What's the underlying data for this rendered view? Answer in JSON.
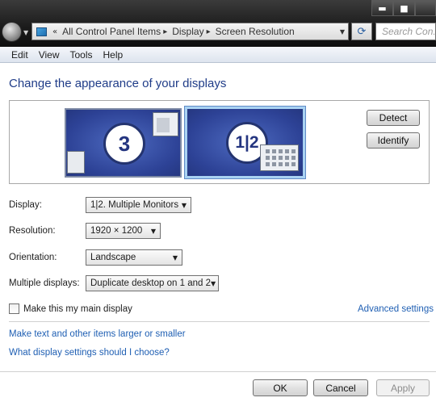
{
  "window": {
    "minimize_glyph": "▬",
    "maximize_glyph": "■",
    "close_glyph": ""
  },
  "address_bar": {
    "overflow_glyph": "«",
    "crumbs": [
      "All Control Panel Items",
      "Display",
      "Screen Resolution"
    ],
    "separator": "▸",
    "dropdown_glyph": "▼",
    "refresh_glyph": "⟳"
  },
  "search": {
    "placeholder": "Search Con..."
  },
  "menu": {
    "items": [
      "Edit",
      "View",
      "Tools",
      "Help"
    ]
  },
  "page": {
    "heading": "Change the appearance of your displays"
  },
  "preview": {
    "monitors": [
      {
        "label": "3"
      },
      {
        "label": "1|2"
      }
    ],
    "detect_label": "Detect",
    "identify_label": "Identify"
  },
  "settings": {
    "display": {
      "label": "Display:",
      "value": "1|2. Multiple Monitors"
    },
    "resolution": {
      "label": "Resolution:",
      "value": "1920 × 1200"
    },
    "orientation": {
      "label": "Orientation:",
      "value": "Landscape"
    },
    "multiple_displays": {
      "label": "Multiple displays:",
      "value": "Duplicate desktop on 1 and 2"
    },
    "dropdown_glyph": "▼"
  },
  "main_display": {
    "label": "Make this my main display",
    "checked": false
  },
  "links": {
    "advanced": "Advanced settings",
    "larger_text": "Make text and other items larger or smaller",
    "which_settings": "What display settings should I choose?"
  },
  "buttons": {
    "ok": "OK",
    "cancel": "Cancel",
    "apply": "Apply",
    "apply_enabled": false
  }
}
